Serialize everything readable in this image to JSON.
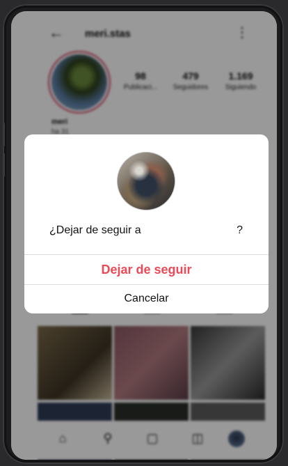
{
  "profile": {
    "username": "meri.stas",
    "name": "meri",
    "subtitle": "ha 31",
    "stats": [
      {
        "value": "98",
        "label": "Publicaci..."
      },
      {
        "value": "479",
        "label": "Seguidores"
      },
      {
        "value": "1.169",
        "label": "Siguiendo"
      }
    ]
  },
  "header": {
    "back_icon": "arrow-left-icon",
    "menu_icon": "more-vertical-icon"
  },
  "grid_colors": [
    "#6b5a3e",
    "#8a5d6a",
    "#4a4a4a",
    "#3a4a66",
    "#2c2c2c",
    "#5a5a5a"
  ],
  "nav": {
    "items": [
      "home-icon",
      "search-icon",
      "reels-icon",
      "shop-icon",
      "profile-avatar"
    ]
  },
  "dialog": {
    "question_text": "¿Dejar de seguir a",
    "question_mark": "?",
    "unfollow_label": "Dejar de seguir",
    "cancel_label": "Cancelar",
    "accent_color": "#ed4956"
  }
}
